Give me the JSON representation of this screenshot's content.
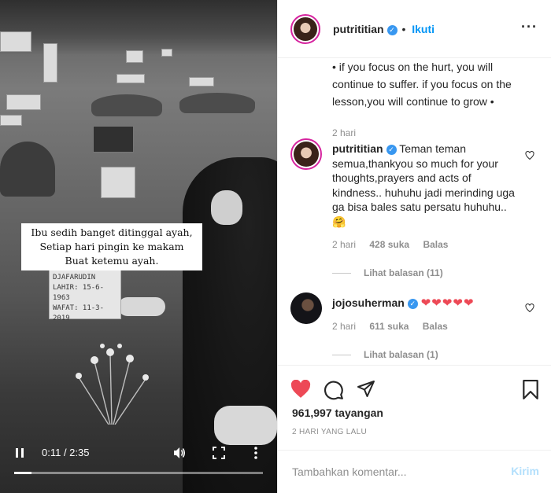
{
  "video": {
    "caption_lines": [
      "Ibu sedih banget ditinggal ayah,",
      "Setiap hari pingin ke makam",
      "Buat ketemu ayah."
    ],
    "tombstone_lines": [
      "DJAFARUDIN",
      "LAHIR: 15-6-1963",
      "WAFAT: 11-3-2019"
    ],
    "time": "0:11 / 2:35",
    "progress_fraction": 0.071
  },
  "header": {
    "username": "putrititian",
    "separator": "•",
    "follow_label": "Ikuti"
  },
  "comments": {
    "caption_continuation": "• if you focus on the hurt, you will continue to suffer. if you focus on the lesson,you will continue to grow •",
    "caption_time": "2 hari",
    "items": [
      {
        "username": "putrititian",
        "text": "Teman teman semua,thankyou so much for your thoughts,prayers and acts of kindness.. huhuhu jadi merinding uga ga bisa bales satu persatu huhuhu.. 🤗",
        "time": "2 hari",
        "likes": "428 suka",
        "reply_label": "Balas",
        "view_replies": "Lihat balasan (11)"
      },
      {
        "username": "jojosuherman",
        "text": "❤❤❤❤❤",
        "time": "2 hari",
        "likes": "611 suka",
        "reply_label": "Balas",
        "view_replies": "Lihat balasan (1)"
      }
    ]
  },
  "actions": {
    "views": "961,997 tayangan",
    "date": "2 HARI YANG LALU"
  },
  "add_comment": {
    "placeholder": "Tambahkan komentar...",
    "post_label": "Kirim"
  },
  "colors": {
    "accent_blue": "#0095f6",
    "like_red": "#ed4956",
    "post_disabled": "#b2dffc"
  },
  "icons": [
    "play-pause-icon",
    "volume-icon",
    "fullscreen-icon",
    "more-vertical-icon",
    "verified-icon",
    "more-horizontal-icon",
    "heart-icon",
    "comment-icon",
    "share-icon",
    "bookmark-icon"
  ]
}
